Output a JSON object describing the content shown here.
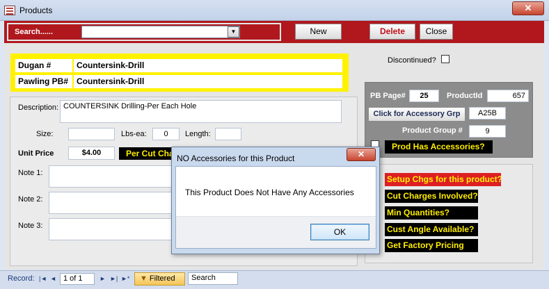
{
  "window": {
    "title": "Products",
    "close_glyph": "✕"
  },
  "header": {
    "search_label": "Search......",
    "search_value": "",
    "dropdown_glyph": "▼",
    "new_label": "New",
    "delete_label": "Delete",
    "close_label": "Close"
  },
  "ids": {
    "dugan_label": "Dugan #",
    "dugan_value": "Countersink-Drill",
    "pawling_label": "Pawling PB#",
    "pawling_value": "Countersink-Drill"
  },
  "info": {
    "description_label": "Description:",
    "description_value": "COUNTERSINK Drilling-Per Each Hole",
    "size_label": "Size:",
    "size_value": "",
    "lbs_label": "Lbs-ea:",
    "lbs_value": "0",
    "length_label": "Length:",
    "length_value": "",
    "unit_price_label": "Unit Price",
    "unit_price_value": "$4.00",
    "per_cut_label": "Per Cut Cha",
    "note1_label": "Note 1:",
    "note2_label": "Note 2:",
    "note3_label": "Note 3:"
  },
  "discontinued": {
    "label": "Discontinued?",
    "checked": false
  },
  "product_panel": {
    "pb_page_label": "PB Page#",
    "pb_page_value": "25",
    "product_id_label": "ProductId",
    "product_id_value": "657",
    "accessory_button": "Click for Accessory Grp",
    "accessory_value": "A25B",
    "product_group_label": "Product Group #",
    "product_group_value": "9",
    "has_accessories_label": "Prod Has Accessories?"
  },
  "charges": {
    "setup": "Setup Chgs for this product?",
    "cut": "Cut Charges Involved?",
    "min": "Min Quantities?",
    "angle": "Cust Angle Available?",
    "factory": "Get Factory Pricing"
  },
  "navbar": {
    "record_label": "Record:",
    "first_glyph": "|◄",
    "prev_glyph": "◄",
    "record_value": "1 of 1",
    "next_glyph": "►",
    "last_glyph": "►|",
    "new_glyph": "►*",
    "filtered_label": "Filtered",
    "search_label": "Search"
  },
  "dialog": {
    "title": "NO Accessories for this Product",
    "message": "This Product Does Not Have Any Accessories",
    "ok_label": "OK",
    "close_glyph": "✕"
  },
  "colors": {
    "header_red": "#b0181d",
    "yellow": "#fff200",
    "label_yellow_text": "#ffee00",
    "setup_red": "#dd1f23"
  }
}
